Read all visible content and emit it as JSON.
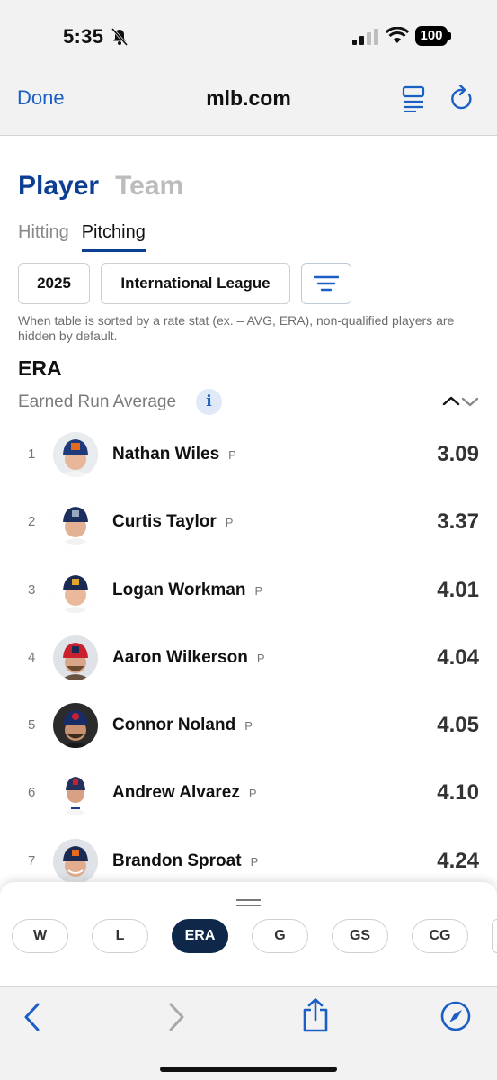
{
  "status": {
    "time": "5:35",
    "battery": "100"
  },
  "browser": {
    "done_label": "Done",
    "url": "mlb.com"
  },
  "tabs": {
    "player": "Player",
    "team": "Team"
  },
  "subtabs": {
    "hitting": "Hitting",
    "pitching": "Pitching"
  },
  "filters": {
    "year": "2025",
    "league": "International League"
  },
  "note": "When table is sorted by a rate stat (ex. – AVG, ERA), non-qualified players are hidden by default.",
  "stat": {
    "abbr": "ERA",
    "name": "Earned Run Average",
    "info": "i"
  },
  "players": [
    {
      "rank": "1",
      "name": "Nathan Wiles",
      "pos": "P",
      "value": "3.09"
    },
    {
      "rank": "2",
      "name": "Curtis Taylor",
      "pos": "P",
      "value": "3.37"
    },
    {
      "rank": "3",
      "name": "Logan Workman",
      "pos": "P",
      "value": "4.01"
    },
    {
      "rank": "4",
      "name": "Aaron Wilkerson",
      "pos": "P",
      "value": "4.04"
    },
    {
      "rank": "5",
      "name": "Connor Noland",
      "pos": "P",
      "value": "4.05"
    },
    {
      "rank": "6",
      "name": "Andrew Alvarez",
      "pos": "P",
      "value": "4.10"
    },
    {
      "rank": "7",
      "name": "Brandon Sproat",
      "pos": "P",
      "value": "4.24"
    }
  ],
  "stat_chips": [
    "W",
    "L",
    "ERA",
    "G",
    "GS",
    "CG"
  ],
  "colors": {
    "brand_blue": "#0c3f93",
    "link_blue": "#1b5fc4",
    "chip_active": "#0f2748"
  }
}
